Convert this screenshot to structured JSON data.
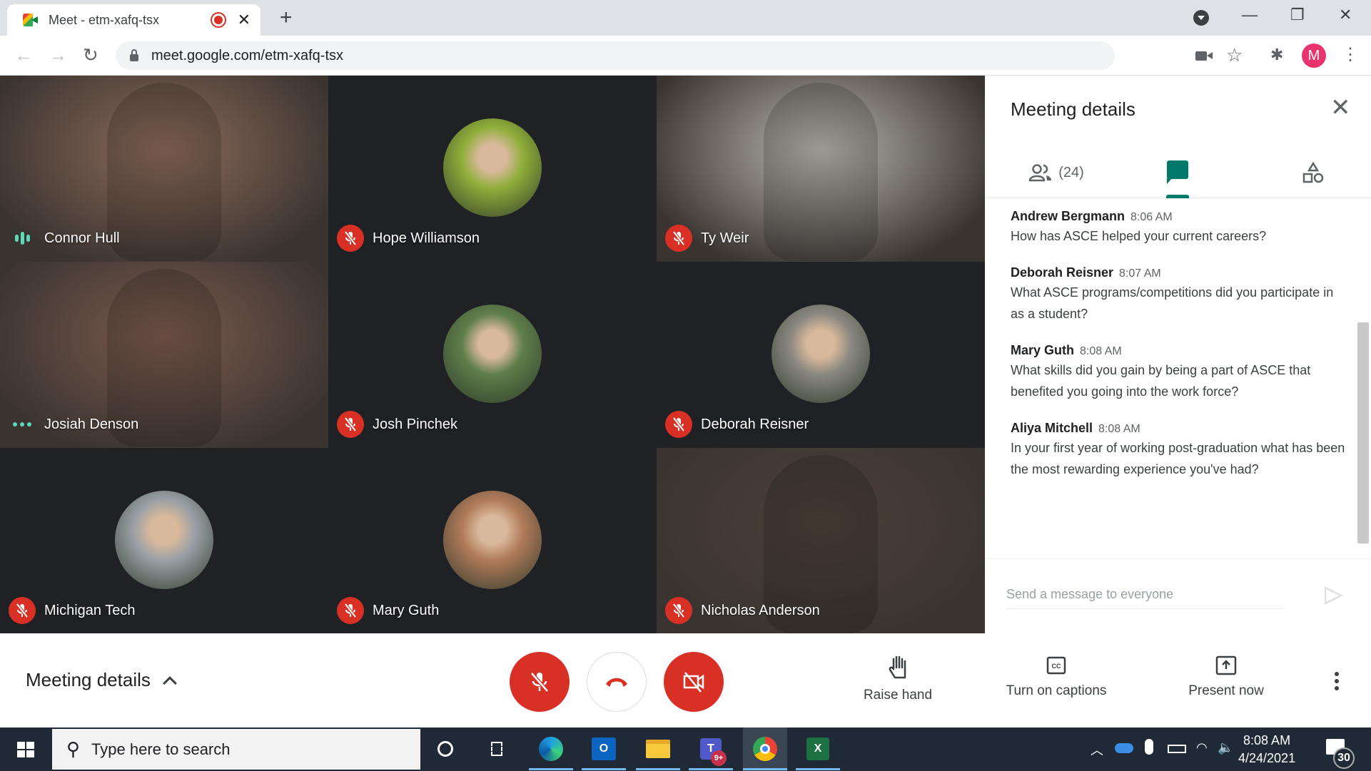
{
  "browser": {
    "tab_title": "Meet - etm-xafq-tsx",
    "url": "meet.google.com/etm-xafq-tsx",
    "profile_initial": "M",
    "profile_color": "#e8336c"
  },
  "participants": [
    {
      "name": "Connor Hull",
      "status": "speaking",
      "mode": "video",
      "bg": "#8b6a5a"
    },
    {
      "name": "Hope Williamson",
      "status": "muted",
      "mode": "avatar",
      "bg": "#8fae3a"
    },
    {
      "name": "Ty Weir",
      "status": "muted",
      "mode": "video",
      "bg": "#b8b4ae"
    },
    {
      "name": "Josiah Denson",
      "status": "typing-dots",
      "mode": "video",
      "bg": "#7a5a4e"
    },
    {
      "name": "Josh Pinchek",
      "status": "muted",
      "mode": "avatar",
      "bg": "#5e7e4a"
    },
    {
      "name": "Deborah Reisner",
      "status": "muted",
      "mode": "avatar",
      "bg": "#8a8880"
    },
    {
      "name": "Michigan Tech",
      "status": "muted",
      "mode": "avatar",
      "bg": "#9aa0a6"
    },
    {
      "name": "Mary Guth",
      "status": "muted",
      "mode": "avatar",
      "bg": "#b07a5a"
    },
    {
      "name": "Nicholas Anderson",
      "status": "muted",
      "mode": "video",
      "bg": "#4a4238"
    }
  ],
  "panel": {
    "title": "Meeting details",
    "people_count": "(24)",
    "active_tab": "chat",
    "accent": "#00796b",
    "messages": [
      {
        "sender": "Andrew Bergmann",
        "time": "8:06 AM",
        "text": "How has ASCE helped your current careers?"
      },
      {
        "sender": "Deborah Reisner",
        "time": "8:07 AM",
        "text": "What ASCE programs/competitions did you participate in as a student?"
      },
      {
        "sender": "Mary Guth",
        "time": "8:08 AM",
        "text": "What skills did you gain by being a part of ASCE that benefited you going into the work force?"
      },
      {
        "sender": "Aliya Mitchell",
        "time": "8:08 AM",
        "text": "In your first year of working post-graduation what has been the most rewarding experience you've had?"
      }
    ],
    "compose_placeholder": "Send a message to everyone"
  },
  "bottombar": {
    "meeting_details_label": "Meeting details",
    "raise_hand_label": "Raise hand",
    "captions_label": "Turn on captions",
    "present_label": "Present now",
    "danger_color": "#d93025"
  },
  "taskbar": {
    "search_placeholder": "Type here to search",
    "time": "8:08 AM",
    "date": "4/24/2021",
    "teams_badge": "9+",
    "notification_count": "30",
    "outlook_letter": "O",
    "excel_letter": "X",
    "teams_letter": "T"
  }
}
